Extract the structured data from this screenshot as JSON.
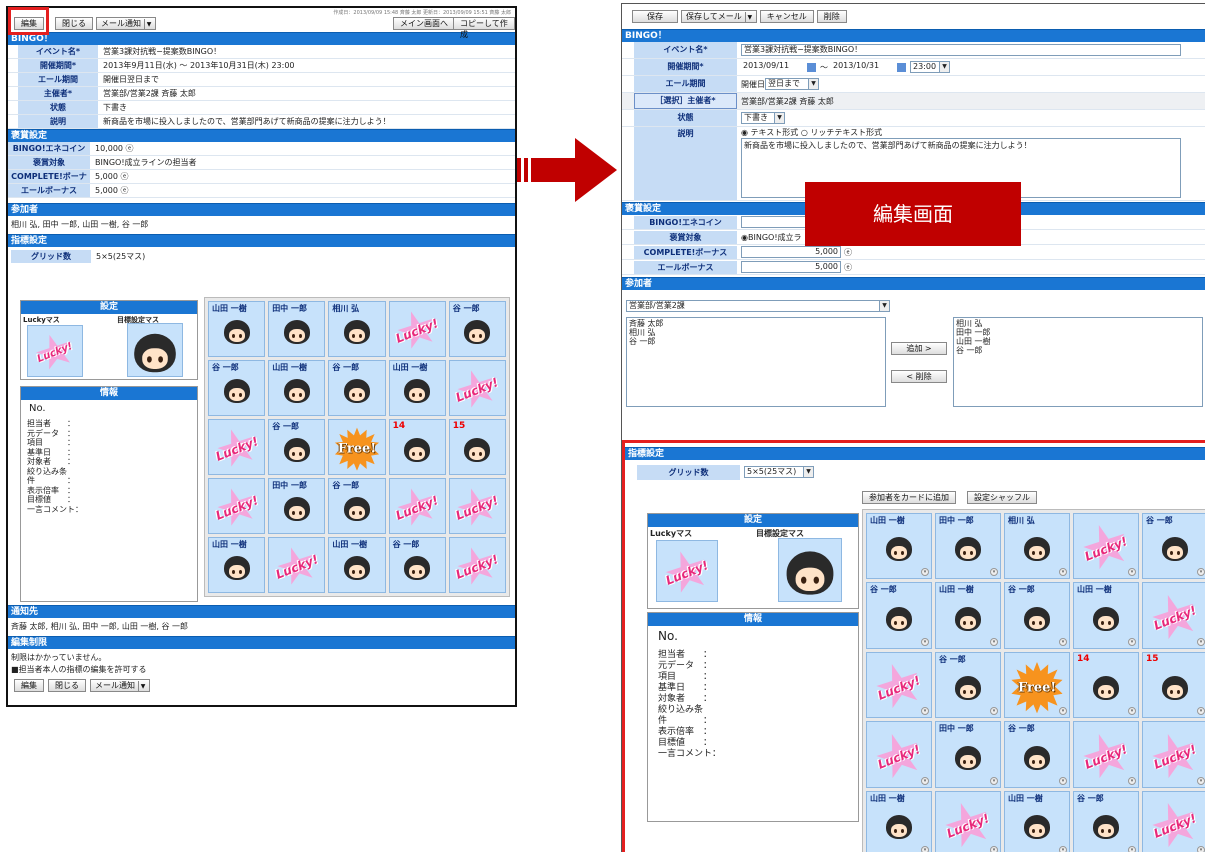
{
  "left": {
    "toolbar": {
      "edit": "編集",
      "close": "閉じる",
      "mail": "メール通知",
      "meta": "作成日：2013/09/09 15:48  斉藤 太郎  更新日：2013/09/09 15:51  斉藤 太郎",
      "main": "メイン画面へ",
      "copy": "コピーして作成"
    },
    "title": "BINGO！",
    "fields": [
      {
        "label": "イベント名*",
        "value": "営業3課対抗戦−提案数BINGO！"
      },
      {
        "label": "開催期間*",
        "value": "2013年9月11日(水) 〜 2013年10月31日(木) 23:00"
      },
      {
        "label": "エール期間",
        "value": "開催日翌日まで"
      },
      {
        "label": "主催者*",
        "value": "営業部/営業2課  斉藤 太郎"
      },
      {
        "label": "状態",
        "value": "下書き"
      },
      {
        "label": "説明",
        "value": "新商品を市場に投入しましたので、営業部門あげて新商品の提案に注力しよう！"
      }
    ],
    "prize_header": "褒賞設定",
    "prize": [
      {
        "label": "BINGO!エネコイン",
        "value": "10,000 ⓔ"
      },
      {
        "label": "褒賞対象",
        "value": "BINGO!成立ラインの担当者"
      },
      {
        "label": "COMPLETE!ボーナス",
        "value": "5,000 ⓔ"
      },
      {
        "label": "エールボーナス",
        "value": "5,000 ⓔ"
      }
    ],
    "participants_header": "参加者",
    "participants": "相川 弘, 田中 一郎, 山田 一樹, 谷 一郎",
    "indicator_header": "指標設定",
    "grid_label": "グリッド数",
    "grid_value": "5×5(25マス)",
    "notify_header": "通知先",
    "notify": "斉藤 太郎, 相川 弘, 田中 一郎, 山田 一樹, 谷 一郎",
    "restrict_header": "編集制限",
    "restrict1": "制限はかかっていません。",
    "restrict2": "■担当者本人の指標の編集を許可する"
  },
  "right": {
    "toolbar": {
      "save": "保存",
      "save_mail": "保存してメール",
      "cancel": "キャンセル",
      "delete": "削除"
    },
    "title": "BINGO！",
    "event_label": "イベント名*",
    "event_value": "営業3課対抗戦−提案数BINGO！",
    "period_label": "開催期間*",
    "start": "2013/09/11",
    "tilde": "〜",
    "end": "2013/10/31",
    "time": "23:00",
    "yell_label": "エール期間",
    "yell_prefix": "開催日",
    "yell_value": "翌日まで",
    "host_label": "［選択］主催者*",
    "host_value": "営業部/営業2課  斉藤 太郎",
    "status_label": "状態",
    "status_value": "下書き",
    "desc_label": "説明",
    "radio1": "テキスト形式",
    "radio2": "リッチテキスト形式",
    "desc_value": "新商品を市場に投入しましたので、営業部門あげて新商品の提案に注力しよう！",
    "overlay": "編集画面",
    "prize_header": "褒賞設定",
    "prize": [
      {
        "label": "BINGO!エネコイン",
        "value": "10"
      },
      {
        "label": "褒賞対象",
        "value": "BINGO!成立ラ"
      },
      {
        "label": "COMPLETE!ボーナス",
        "value": "5,000"
      },
      {
        "label": "エールボーナス",
        "value": "5,000"
      }
    ],
    "coin": "ⓔ",
    "participants_header": "参加者",
    "dept": "営業部/営業2課",
    "avail": [
      "斉藤 太郎",
      "相川 弘",
      "谷 一郎"
    ],
    "add": "追加 >",
    "remove": "< 削除",
    "selected": [
      "相川 弘",
      "田中 一郎",
      "山田 一樹",
      "谷 一郎"
    ],
    "indicator_header": "指標設定",
    "grid_label": "グリッド数",
    "grid_value": "5×5(25マス)",
    "add_card": "参加者をカードに追加",
    "shuffle": "設定シャッフル"
  },
  "settings": {
    "title": "設定",
    "lucky": "Luckyマス",
    "target": "目標設定マス"
  },
  "info": {
    "title": "情報",
    "no": "No.",
    "lines": [
      "担当者　　：",
      "元データ　：",
      "項目　　　：",
      "基準日　　：",
      "対象者　　：",
      "絞り込み条",
      "件　　　　：",
      "表示倍率　：",
      "目標値　　：",
      "一言コメント："
    ]
  },
  "bingo_cells": [
    {
      "type": "person",
      "name": "山田 一樹"
    },
    {
      "type": "person",
      "name": "田中 一郎"
    },
    {
      "type": "person",
      "name": "相川 弘"
    },
    {
      "type": "lucky",
      "name": ""
    },
    {
      "type": "person",
      "name": "谷 一郎"
    },
    {
      "type": "person",
      "name": "谷 一郎"
    },
    {
      "type": "person",
      "name": "山田 一樹"
    },
    {
      "type": "person",
      "name": "谷 一郎"
    },
    {
      "type": "person",
      "name": "山田 一樹"
    },
    {
      "type": "lucky",
      "name": ""
    },
    {
      "type": "lucky",
      "name": ""
    },
    {
      "type": "person",
      "name": "谷 一郎"
    },
    {
      "type": "free",
      "name": ""
    },
    {
      "type": "num",
      "name": "14"
    },
    {
      "type": "num",
      "name": "15"
    },
    {
      "type": "lucky",
      "name": ""
    },
    {
      "type": "person",
      "name": "田中 一郎"
    },
    {
      "type": "person",
      "name": "谷 一郎"
    },
    {
      "type": "lucky",
      "name": ""
    },
    {
      "type": "lucky",
      "name": ""
    },
    {
      "type": "person",
      "name": "山田 一樹"
    },
    {
      "type": "lucky",
      "name": ""
    },
    {
      "type": "person",
      "name": "山田 一樹"
    },
    {
      "type": "person",
      "name": "谷 一郎"
    },
    {
      "type": "lucky",
      "name": ""
    }
  ],
  "lucky_text": "Lucky!",
  "free_text": "Free!"
}
